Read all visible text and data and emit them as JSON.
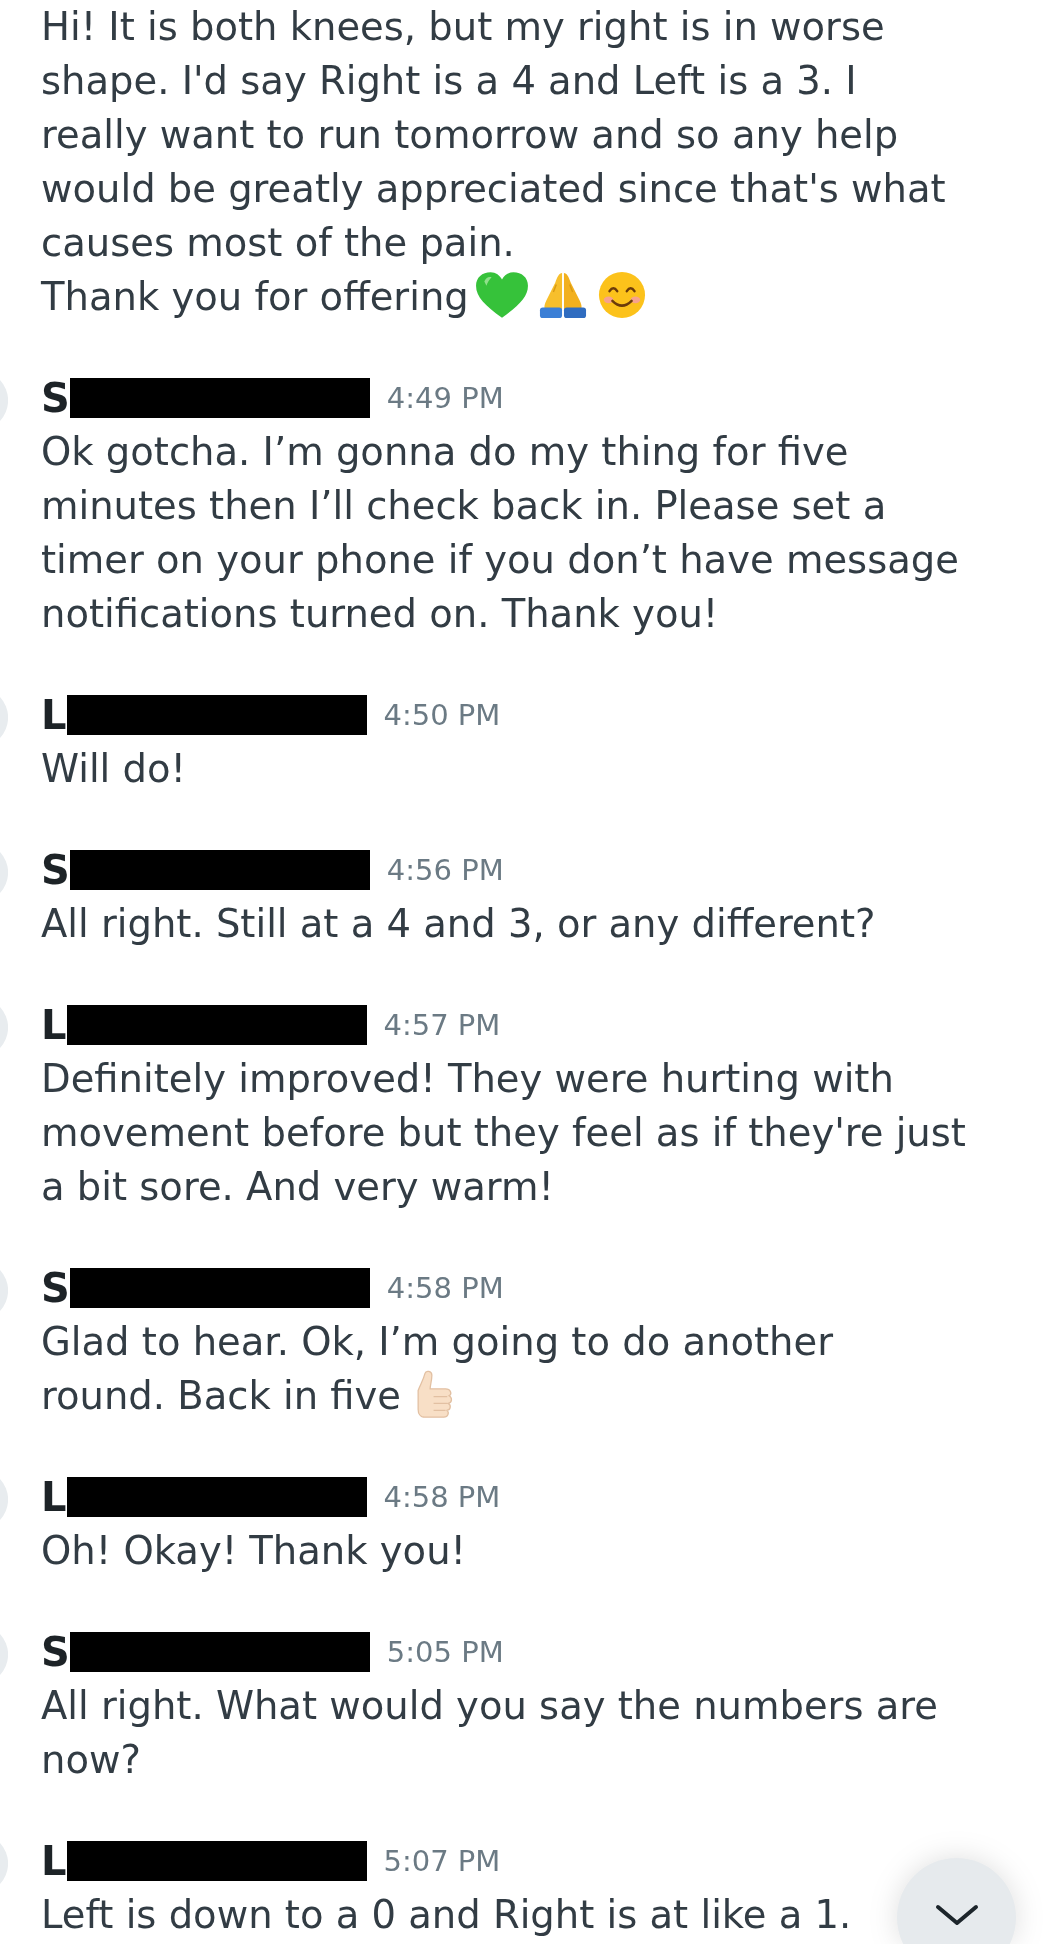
{
  "messages": [
    {
      "paragraphs": [
        "Hi! It is both knees, but my right is in worse shape. I'd say Right is a 4 and Left is a 3. I really want to run tomorrow and so any help would be greatly appreciated since that's what causes most of the pain.",
        "Thank you for offering"
      ],
      "icons": [
        {
          "kind": "heart"
        },
        {
          "kind": "hands"
        },
        {
          "kind": "smiley"
        }
      ]
    },
    {
      "sender": {
        "initial": "S",
        "redacted": true
      },
      "time": "4:49 PM",
      "paragraphs": [
        "Ok gotcha. I’m gonna do my thing for five minutes then I’ll check back in. Please set a timer on your phone if you don’t have message notifications turned on. Thank you!"
      ]
    },
    {
      "sender": {
        "initial": "L",
        "redacted": true
      },
      "time": "4:50 PM",
      "paragraphs": [
        "Will do!"
      ]
    },
    {
      "sender": {
        "initial": "S",
        "redacted": true
      },
      "time": "4:56 PM",
      "paragraphs": [
        "All right. Still at a 4 and 3, or any different?"
      ]
    },
    {
      "sender": {
        "initial": "L",
        "redacted": true
      },
      "time": "4:57 PM",
      "paragraphs": [
        "Definitely improved! They were hurting with movement before but they feel as if they're just a bit sore. And very warm!"
      ]
    },
    {
      "sender": {
        "initial": "S",
        "redacted": true
      },
      "time": "4:58 PM",
      "paragraphs": [
        "Glad to hear. Ok, I’m going to do another",
        "round. Back in five"
      ],
      "icons": [
        {
          "kind": "thumbsup"
        }
      ]
    },
    {
      "sender": {
        "initial": "L",
        "redacted": true
      },
      "time": "4:58 PM",
      "paragraphs": [
        "Oh! Okay! Thank you!"
      ]
    },
    {
      "sender": {
        "initial": "S",
        "redacted": true
      },
      "time": "5:05 PM",
      "paragraphs": [
        "All right. What would you say the numbers are now?"
      ]
    },
    {
      "sender": {
        "initial": "L",
        "redacted": true
      },
      "time": "5:07 PM",
      "paragraphs": [
        "Left is down to a 0 and Right is at like a 1."
      ]
    }
  ],
  "scroll_down_button": {
    "shown": true
  }
}
